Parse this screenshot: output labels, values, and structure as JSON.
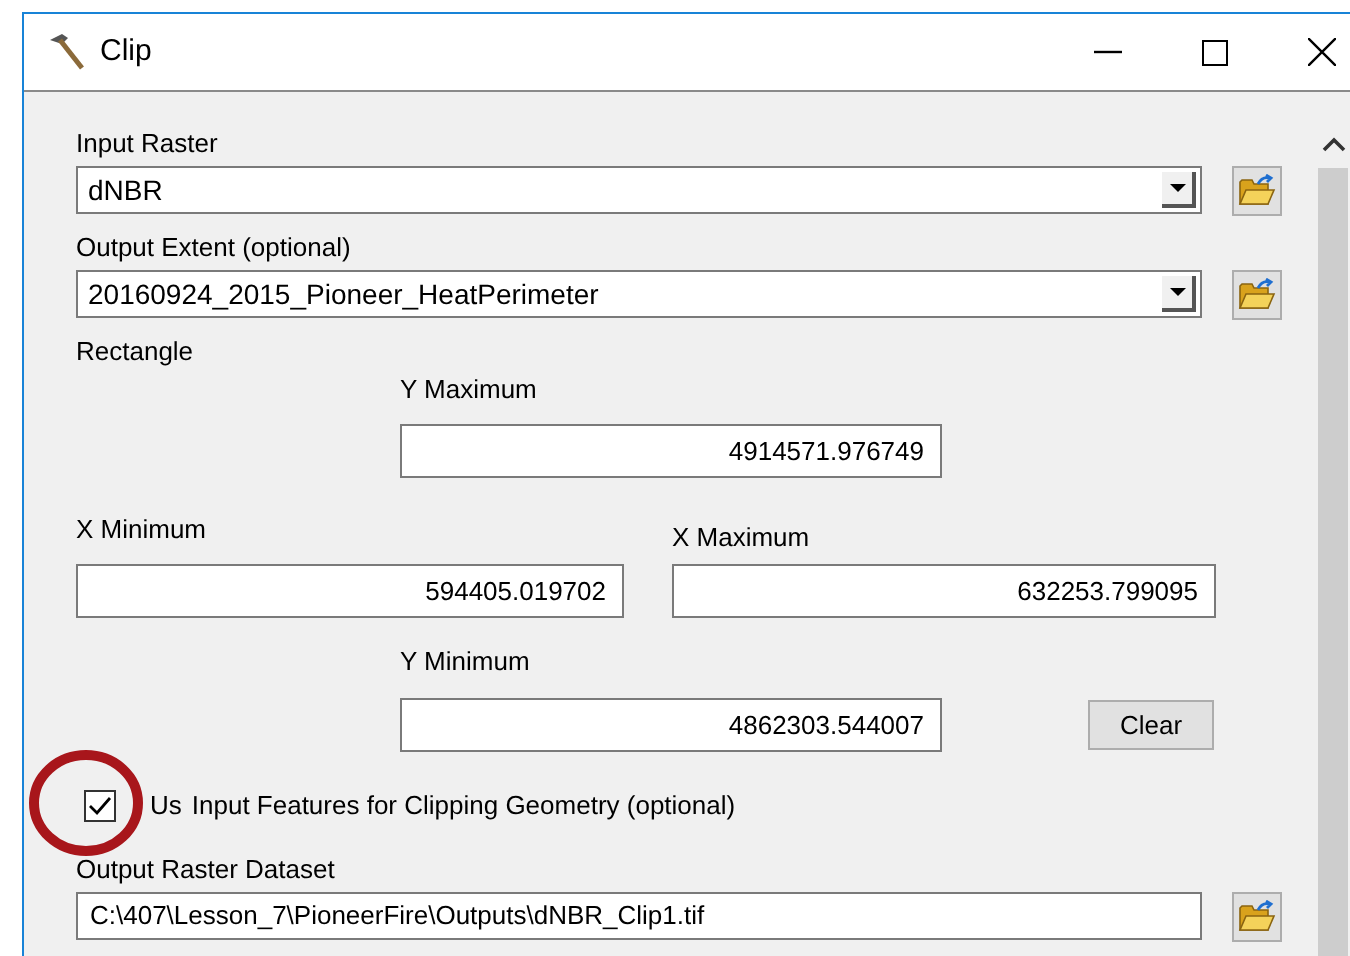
{
  "window": {
    "title": "Clip"
  },
  "input_raster": {
    "label": "Input Raster",
    "value": "dNBR"
  },
  "output_extent": {
    "label": "Output Extent (optional)",
    "value": "20160924_2015_Pioneer_HeatPerimeter"
  },
  "rectangle": {
    "label": "Rectangle",
    "y_maximum": {
      "label": "Y Maximum",
      "value": "4914571.976749"
    },
    "x_minimum": {
      "label": "X Minimum",
      "value": "594405.019702"
    },
    "x_maximum": {
      "label": "X Maximum",
      "value": "632253.799095"
    },
    "y_minimum": {
      "label": "Y Minimum",
      "value": "4862303.544007"
    },
    "clear_button": "Clear"
  },
  "use_input_features": {
    "checked": true,
    "label_start": "Us",
    "label_rest": "Input Features for Clipping Geometry (optional)"
  },
  "output_raster_dataset": {
    "label": "Output Raster Dataset",
    "value": "C:\\407\\Lesson_7\\PioneerFire\\Outputs\\dNBR_Clip1.tif"
  }
}
